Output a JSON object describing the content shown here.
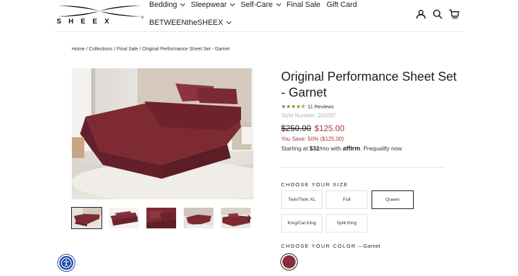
{
  "brand": {
    "logo_text": "SHEEX",
    "logo_reg": "®"
  },
  "nav": {
    "items": [
      {
        "label": "Bedding",
        "dropdown": true
      },
      {
        "label": "Sleepwear",
        "dropdown": true
      },
      {
        "label": "Self-Care",
        "dropdown": true
      },
      {
        "label": "Final Sale",
        "dropdown": false
      },
      {
        "label": "Gift Card",
        "dropdown": false
      },
      {
        "label": "BETWEENtheSHEEX",
        "dropdown": true
      }
    ]
  },
  "header_icons": [
    "account-icon",
    "search-icon",
    "cart-icon"
  ],
  "breadcrumb": {
    "items": [
      "Home",
      "Collections",
      "Final Sale",
      "Original Performance Sheet Set - Garnet"
    ],
    "separator": "/"
  },
  "product": {
    "title": "Original Performance Sheet Set - Garnet",
    "rating": 4.5,
    "reviews_label": "11 Reviews",
    "style_number": "Style Number: 201097",
    "price_original": "$250.00",
    "price_sale": "$125.00",
    "savings": "You Save: 50% ($125.00)",
    "affirm": {
      "prefix": "Starting at",
      "amount": "$32",
      "suffix": "/mo with",
      "brand": "affirm",
      "link": ". Prequalify now"
    },
    "size_label": "CHOOSE YOUR SIZE",
    "sizes": [
      {
        "label": "Twin/Twin XL",
        "selected": false
      },
      {
        "label": "Full",
        "selected": false
      },
      {
        "label": "Queen",
        "selected": true
      },
      {
        "label": "King/Cal King",
        "selected": false
      },
      {
        "label": "Split King",
        "selected": false
      }
    ],
    "color_label": "CHOOSE YOUR COLOR",
    "color_value": "– Garnet",
    "color_hex": "#8a2f3a",
    "thumbnail_count": 5,
    "active_thumbnail": 1
  },
  "colors": {
    "sale": "#a43a3a",
    "accessibility": "#1e4aa8",
    "garnet": "#7d2a33"
  }
}
